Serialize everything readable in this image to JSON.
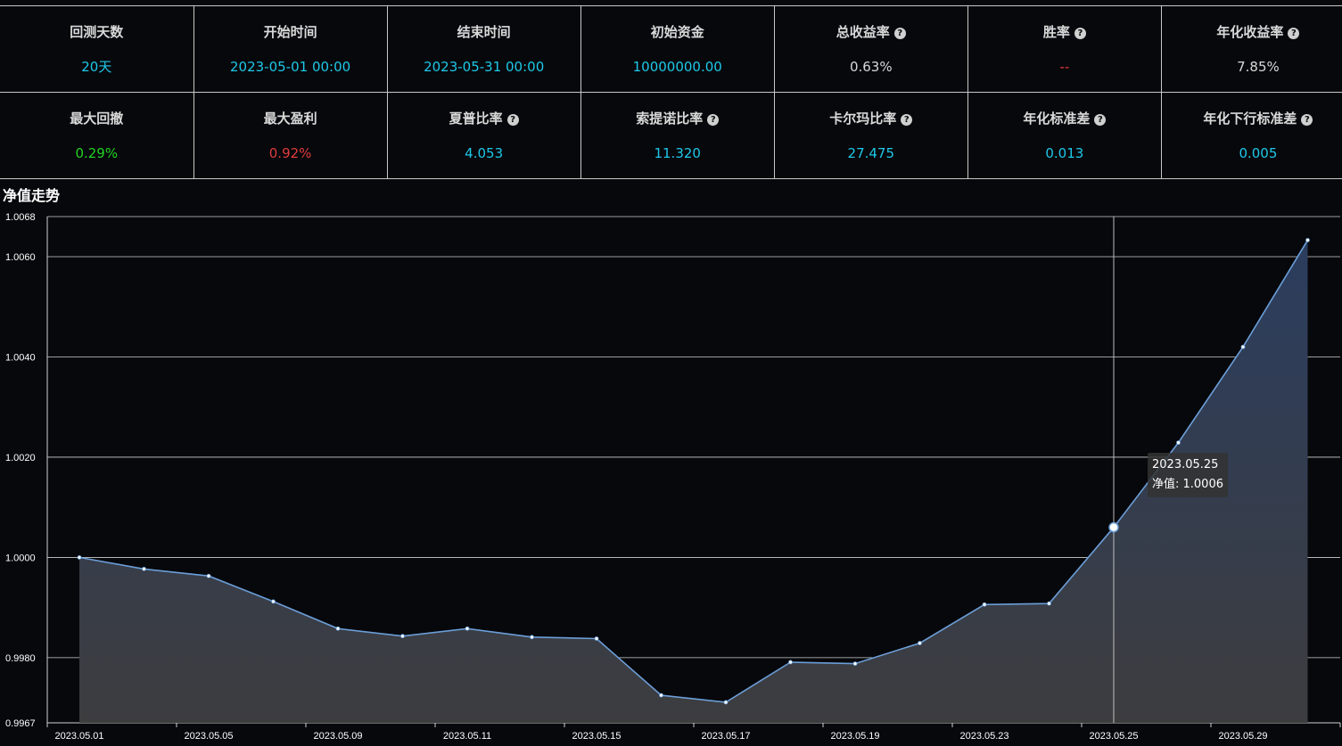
{
  "stats": {
    "row1": [
      {
        "label": "回测天数",
        "value": "20天",
        "color": "#1ec8e8",
        "help": false
      },
      {
        "label": "开始时间",
        "value": "2023-05-01 00:00",
        "color": "#1ec8e8",
        "help": false
      },
      {
        "label": "结束时间",
        "value": "2023-05-31 00:00",
        "color": "#1ec8e8",
        "help": false
      },
      {
        "label": "初始资金",
        "value": "10000000.00",
        "color": "#1ec8e8",
        "help": false
      },
      {
        "label": "总收益率",
        "value": "0.63%",
        "color": "#d8d8d8",
        "help": true
      },
      {
        "label": "胜率",
        "value": "--",
        "color": "#e03c3c",
        "help": true
      },
      {
        "label": "年化收益率",
        "value": "7.85%",
        "color": "#d8d8d8",
        "help": true
      }
    ],
    "row2": [
      {
        "label": "最大回撤",
        "value": "0.29%",
        "color": "#22d422",
        "help": false
      },
      {
        "label": "最大盈利",
        "value": "0.92%",
        "color": "#e03c3c",
        "help": false
      },
      {
        "label": "夏普比率",
        "value": "4.053",
        "color": "#1ec8e8",
        "help": true
      },
      {
        "label": "索提诺比率",
        "value": "11.320",
        "color": "#1ec8e8",
        "help": true
      },
      {
        "label": "卡尔玛比率",
        "value": "27.475",
        "color": "#1ec8e8",
        "help": true
      },
      {
        "label": "年化标准差",
        "value": "0.013",
        "color": "#1ec8e8",
        "help": true
      },
      {
        "label": "年化下行标准差",
        "value": "0.005",
        "color": "#1ec8e8",
        "help": true
      }
    ],
    "help_glyph": "?"
  },
  "section_title": "净值走势",
  "tooltip": {
    "date": "2023.05.25",
    "label": "净值: 1.0006"
  },
  "chart_data": {
    "type": "area",
    "title": "",
    "xlabel": "",
    "ylabel": "",
    "ylim": [
      0.9967,
      1.0068
    ],
    "yticks": [
      "0.9967",
      "0.9980",
      "1.0000",
      "1.0020",
      "1.0040",
      "1.0060",
      "1.0068"
    ],
    "xtick_labels": [
      "2023.05.01",
      "2023.05.05",
      "2023.05.09",
      "2023.05.11",
      "2023.05.15",
      "2023.05.17",
      "2023.05.19",
      "2023.05.23",
      "2023.05.25",
      "2023.05.29"
    ],
    "grid": true,
    "highlighted_point": "2023.05.25",
    "series": [
      {
        "x": [
          "2023.05.01",
          "2023.05.04",
          "2023.05.05",
          "2023.05.08",
          "2023.05.09",
          "2023.05.10",
          "2023.05.11",
          "2023.05.12",
          "2023.05.15",
          "2023.05.16",
          "2023.05.17",
          "2023.05.18",
          "2023.05.19",
          "2023.05.22",
          "2023.05.23",
          "2023.05.24",
          "2023.05.25",
          "2023.05.26",
          "2023.05.29",
          "2023.05.30",
          "2023.05.31"
        ],
        "values": [
          1.0,
          0.99977,
          0.99963,
          0.99912,
          0.99858,
          0.99843,
          0.99858,
          0.99841,
          0.99838,
          0.99725,
          0.99711,
          0.99791,
          0.99788,
          0.99829,
          0.99906,
          0.99908,
          1.0006,
          1.00229,
          1.0042,
          1.00633,
          null
        ]
      }
    ],
    "line_color": "#6b9ed8",
    "area_top_color": "#2b3d5e",
    "area_bottom_color": "#3d3d3f"
  }
}
